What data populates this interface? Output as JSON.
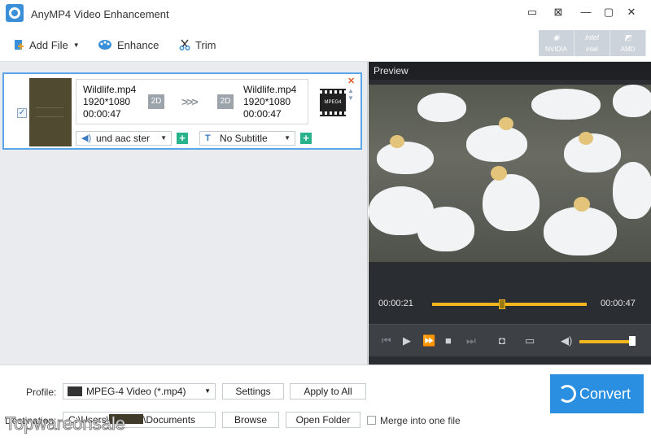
{
  "window": {
    "title": "AnyMP4 Video Enhancement",
    "controls": {
      "feedback": "▭",
      "register": "⊠",
      "minimize": "—",
      "maximize": "▢",
      "close": "✕"
    }
  },
  "toolbar": {
    "add_file": "Add File",
    "enhance": "Enhance",
    "trim": "Trim",
    "hw": [
      {
        "brand": "NVIDIA",
        "mark": ""
      },
      {
        "brand": "intel",
        "mark": "intel"
      },
      {
        "brand": "AMD",
        "mark": ""
      }
    ]
  },
  "file": {
    "source": {
      "name": "Wildlife.mp4",
      "resolution": "1920*1080",
      "duration": "00:00:47"
    },
    "output": {
      "name": "Wildlife.mp4",
      "resolution": "1920*1080",
      "duration": "00:00:47"
    },
    "mode_in": "2D",
    "mode_out": "2D",
    "arrows": ">>>",
    "format_label": "MPEG4",
    "audio": "und aac ster",
    "subtitle": "No Subtitle"
  },
  "preview": {
    "title": "Preview",
    "time_current": "00:00:21",
    "time_total": "00:00:47",
    "progress": 0.45,
    "volume": 0.95
  },
  "bottom": {
    "profile_label": "Profile:",
    "profile_value": "MPEG-4 Video (*.mp4)",
    "settings": "Settings",
    "apply_all": "Apply to All",
    "destination_label": "Destination:",
    "destination_prefix": "C:\\Users\\",
    "destination_suffix": "\\Documents",
    "browse": "Browse",
    "open_folder": "Open Folder",
    "merge": "Merge into one file",
    "convert": "Convert"
  },
  "watermark": "Topwareonsale",
  "colors": {
    "accent": "#2a8fe0",
    "progress": "#f2b71e",
    "selection": "#5aa6e8"
  }
}
